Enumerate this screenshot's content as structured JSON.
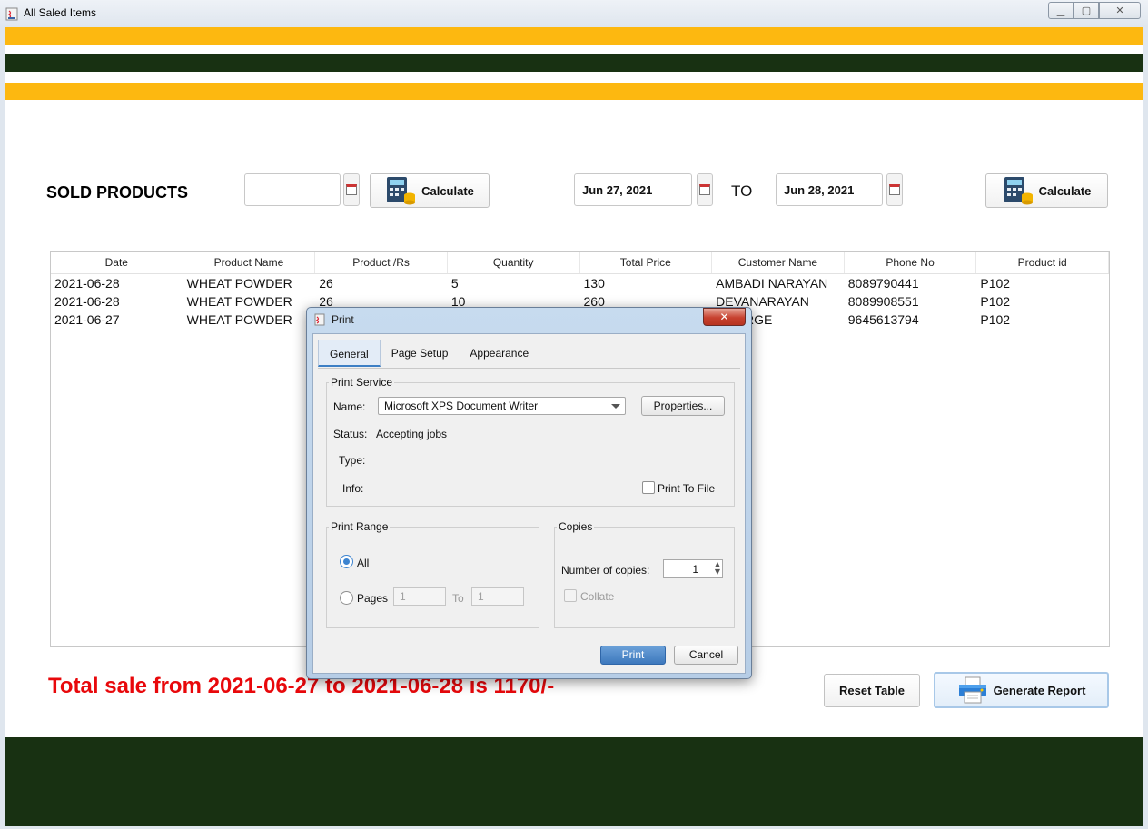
{
  "window": {
    "title": "All Saled Items"
  },
  "main": {
    "heading": "SOLD PRODUCTS",
    "single_date": "",
    "calc_left_label": "Calculate",
    "from_date": "Jun 27, 2021",
    "to_label": "TO",
    "to_date": "Jun 28, 2021",
    "calc_right_label": "Calculate",
    "total_text": "Total sale from 2021-06-27 to 2021-06-28 is 1170/-",
    "reset_label": "Reset Table",
    "report_label": "Generate Report"
  },
  "table": {
    "columns": [
      "Date",
      "Product Name",
      "Product /Rs",
      "Quantity",
      "Total Price",
      "Customer Name",
      "Phone No",
      "Product id"
    ],
    "rows": [
      [
        "2021-06-28",
        "WHEAT POWDER",
        "26",
        "5",
        "130",
        "AMBADI NARAYAN",
        "8089790441",
        "P102"
      ],
      [
        "2021-06-28",
        "WHEAT POWDER",
        "26",
        "10",
        "260",
        "DEVANARAYAN",
        "8089908551",
        "P102"
      ],
      [
        "2021-06-27",
        "WHEAT POWDER",
        "",
        "",
        "",
        "...EORGE",
        "9645613794",
        "P102"
      ]
    ]
  },
  "dialog": {
    "title": "Print",
    "tabs": [
      "General",
      "Page Setup",
      "Appearance"
    ],
    "print_service_label": "Print Service",
    "name_label": "Name:",
    "printer_name": "Microsoft XPS Document Writer",
    "properties_label": "Properties...",
    "status_label": "Status:",
    "status_value": "Accepting jobs",
    "type_label": "Type:",
    "info_label": "Info:",
    "print_to_file_label": "Print To File",
    "print_range_label": "Print Range",
    "all_label": "All",
    "pages_label": "Pages",
    "pages_from": "1",
    "to_label": "To",
    "pages_to": "1",
    "copies_label": "Copies",
    "num_copies_label": "Number of copies:",
    "num_copies": "1",
    "collate_label": "Collate",
    "print_label": "Print",
    "cancel_label": "Cancel"
  },
  "colors": {
    "accent_yellow": "#fdb810",
    "dark_green": "#183112",
    "total_red": "#e8080b"
  }
}
